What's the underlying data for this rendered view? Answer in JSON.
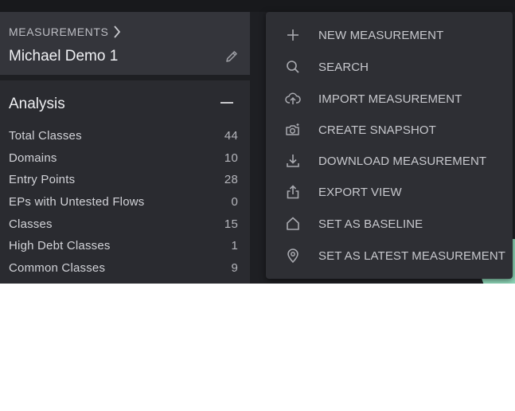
{
  "breadcrumb": {
    "label": "MEASUREMENTS"
  },
  "measurement": {
    "name": "Michael Demo 1"
  },
  "analysis": {
    "title": "Analysis",
    "stats": [
      {
        "label": "Total Classes",
        "value": "44"
      },
      {
        "label": "Domains",
        "value": "10"
      },
      {
        "label": "Entry Points",
        "value": "28"
      },
      {
        "label": "EPs with Untested Flows",
        "value": "0"
      },
      {
        "label": "Classes",
        "value": "15"
      },
      {
        "label": "High Debt Classes",
        "value": "1"
      },
      {
        "label": "Common Classes",
        "value": "9"
      }
    ]
  },
  "menu": {
    "items": [
      {
        "label": "NEW MEASUREMENT",
        "icon": "plus-icon"
      },
      {
        "label": "SEARCH",
        "icon": "search-icon"
      },
      {
        "label": "IMPORT MEASUREMENT",
        "icon": "cloud-upload-icon"
      },
      {
        "label": "CREATE SNAPSHOT",
        "icon": "camera-icon"
      },
      {
        "label": "DOWNLOAD MEASUREMENT",
        "icon": "download-icon"
      },
      {
        "label": "EXPORT VIEW",
        "icon": "share-icon"
      },
      {
        "label": "SET AS BASELINE",
        "icon": "home-icon"
      },
      {
        "label": "SET AS LATEST MEASUREMENT",
        "icon": "location-pin-icon"
      }
    ]
  },
  "colors": {
    "background": "#1e1f23",
    "panel": "#2a2b30",
    "menu": "#2e2f34",
    "accent": "#8fd8b9"
  }
}
